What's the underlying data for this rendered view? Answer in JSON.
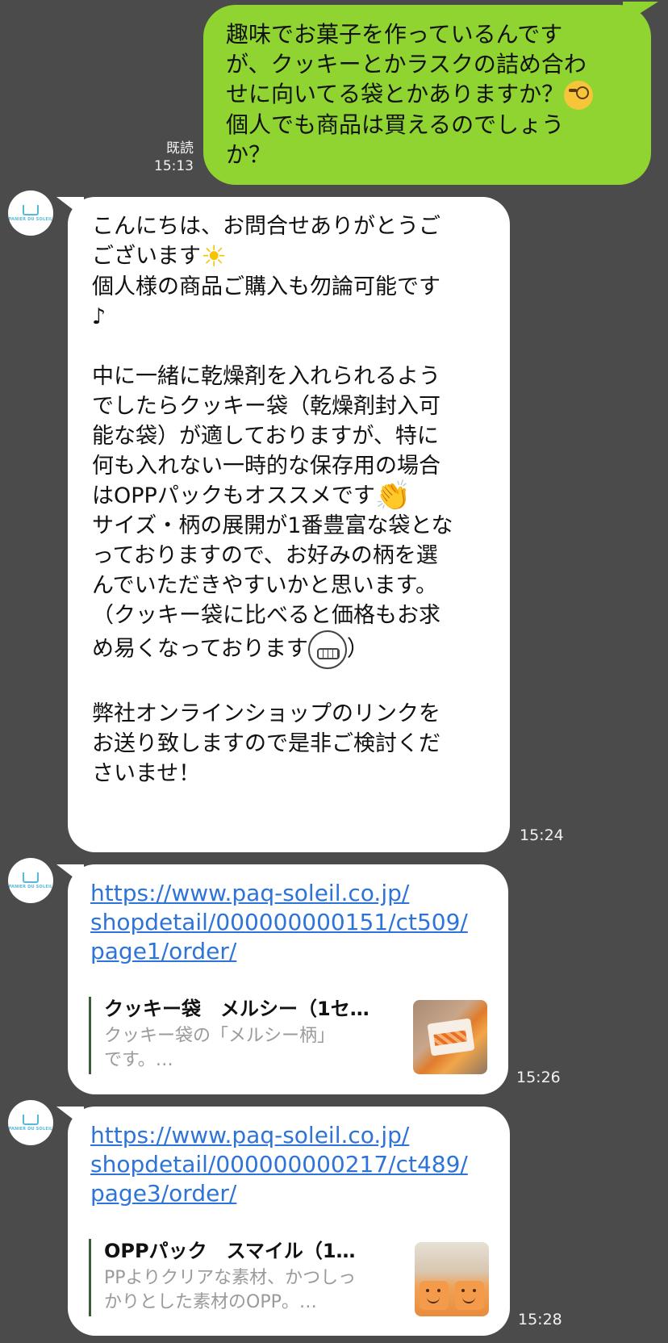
{
  "sent": {
    "text": "趣味でお菓子を作っているんです\nが、クッキーとかラスクの詰め合わ\nせに向いてる袋とかありますか？",
    "text2": "\n個人でも商品は買えるのでしょう\nか？",
    "emoji": "face-with-monocle",
    "read_label": "既読",
    "time": "15:13"
  },
  "avatar": {
    "logo_text": "PANIER DU SOLEIL"
  },
  "reply1": {
    "line1": "こんにちは、お問合せありがとうご\nございます",
    "sun_emoji": "☀",
    "line2": "\n個人様の商品ご購入も勿論可能です\n♪\n\n中に一緒に乾燥剤を入れられるよう\nでしたらクッキー袋（乾燥剤封入可\n能な袋）が適しておりますが、特に\n何も入れない一時的な保存用の場合\nはOPPパックもオススメです",
    "clap_emoji": "👏",
    "line3": "\nサイズ・柄の展開が1番豊富な袋とな\nっておりますので、お好みの柄を選\nんでいただきやすいかと思います。\n（クッキー袋に比べると価格もお求\nめ易くなっております",
    "grin_emoji": "grinning-face",
    "line4": "）\n\n弊社オンラインショップのリンクを\nお送り致しますので是非ご検討くだ\nさいませ！",
    "time": "15:24"
  },
  "link1": {
    "url": "https://www.paq-soleil.co.jp/\nshopdetail/000000000151/ct509/\npage1/order/",
    "preview_title": "クッキー袋　メルシー（1セ…",
    "preview_desc": "クッキー袋の「メルシー柄」\nです。…",
    "time": "15:26"
  },
  "link2": {
    "url": "https://www.paq-soleil.co.jp/\nshopdetail/000000000217/ct489/\npage3/order/",
    "preview_title": "OPPパック　スマイル（1…",
    "preview_desc": "PPよりクリアな素材、かつしっ\nかりとした素材のOPP。…",
    "time": "15:28"
  }
}
